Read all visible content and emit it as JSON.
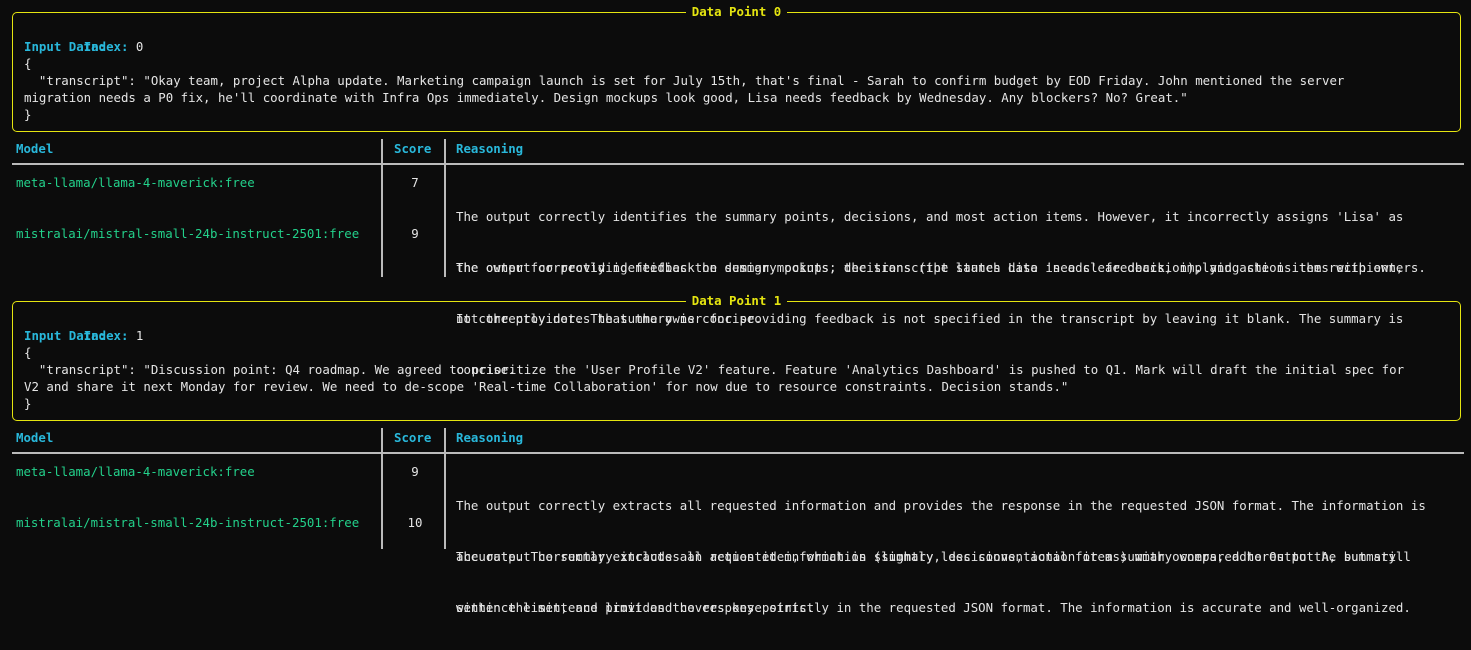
{
  "colors": {
    "background": "#0c0c0c",
    "panel_border": "#e5e510",
    "key_label": "#29b8db",
    "model_name": "#23d18b",
    "text": "#e5e5e5",
    "table_rule": "#bbbbbb"
  },
  "data_points": [
    {
      "title": "Data Point 0",
      "index_label": "Index:",
      "index_value": "0",
      "input_label": "Input Data:",
      "json_lines": [
        "{",
        "  \"transcript\": \"Okay team, project Alpha update. Marketing campaign launch is set for July 15th, that's final - Sarah to confirm budget by EOD Friday. John mentioned the server",
        "migration needs a P0 fix, he'll coordinate with Infra Ops immediately. Design mockups look good, Lisa needs feedback by Wednesday. Any blockers? No? Great.\"",
        "}"
      ],
      "table": {
        "headers": {
          "model": "Model",
          "score": "Score",
          "reasoning": "Reasoning"
        },
        "rows": [
          {
            "model": "meta-llama/llama-4-maverick:free",
            "score": "7",
            "reasoning_lines": [
              "The output correctly identifies the summary points, decisions, and most action items. However, it incorrectly assigns 'Lisa' as",
              "the owner for providing feedback on design mockups; the transcript states Lisa 'needs' feedback, implying she is the recipient,",
              "not the provider. The summary is concise."
            ]
          },
          {
            "model": "mistralai/mistral-small-24b-instruct-2501:free",
            "score": "9",
            "reasoning_lines": [
              "The output correctly identifies the summary points, decisions (the launch date is a clear decision), and action items with owners.",
              "It correctly notes that the owner for providing feedback is not specified in the transcript by leaving it blank. The summary is",
              "concise."
            ]
          }
        ]
      }
    },
    {
      "title": "Data Point 1",
      "index_label": "Index:",
      "index_value": "1",
      "input_label": "Input Data:",
      "json_lines": [
        "{",
        "  \"transcript\": \"Discussion point: Q4 roadmap. We agreed to prioritize the 'User Profile V2' feature. Feature 'Analytics Dashboard' is pushed to Q1. Mark will draft the initial spec for",
        "V2 and share it next Monday for review. We need to de-scope 'Real-time Collaboration' for now due to resource constraints. Decision stands.\"",
        "}"
      ],
      "table": {
        "headers": {
          "model": "Model",
          "score": "Score",
          "reasoning": "Reasoning"
        },
        "rows": [
          {
            "model": "meta-llama/llama-4-maverick:free",
            "score": "9",
            "reasoning_lines": [
              "The output correctly extracts all requested information and provides the response in the requested JSON format. The information is",
              "accurate. The summary includes an action item, which is slightly less conventional for a summary compared to Output A, but still",
              "within the sentence limit and covers key points."
            ]
          },
          {
            "model": "mistralai/mistral-small-24b-instruct-2501:free",
            "score": "10",
            "reasoning_lines": [
              "The output correctly extracts all requested information (summary, decisions, action items) with owners, adheres to the summary",
              "sentence limit, and provides the response strictly in the requested JSON format. The information is accurate and well-organized."
            ]
          }
        ]
      }
    }
  ]
}
